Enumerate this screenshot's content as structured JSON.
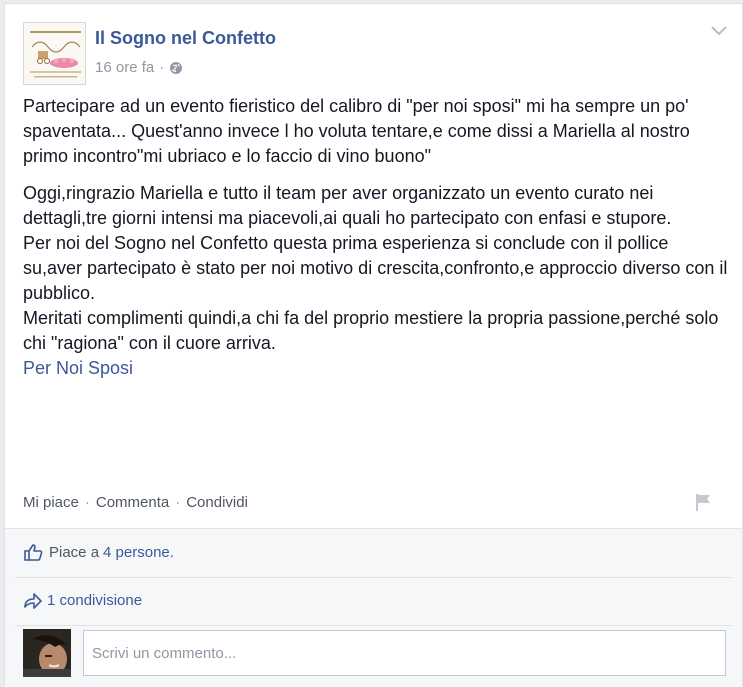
{
  "post": {
    "page_name": "Il Sogno nel Confetto",
    "time": "16 ore fa",
    "dot": "·",
    "audience_icon": "globe-icon",
    "paragraph_1": "Partecipare ad un evento fieristico del calibro di \"per noi sposi\" mi ha sempre un po' spaventata... Quest'anno invece l ho voluta tentare,e come dissi a Mariella al nostro primo incontro\"mi ubriaco e lo faccio di vino buono\"",
    "paragraph_2": "Oggi,ringrazio Mariella e tutto il team per aver organizzato un evento curato nei dettagli,tre giorni intensi ma piacevoli,ai quali ho partecipato con enfasi e stupore.",
    "paragraph_3": "Per noi del Sogno nel Confetto questa prima esperienza si conclude con il pollice su,aver partecipato è stato per noi motivo di crescita,confronto,e approccio diverso con il pubblico.",
    "paragraph_4": "Meritati complimenti quindi,a chi fa del proprio mestiere la propria passione,perché solo chi \"ragiona\" con il cuore arriva.",
    "tag": "Per Noi Sposi"
  },
  "actions": {
    "like": "Mi piace",
    "comment": "Commenta",
    "share": "Condividi",
    "sep": "·",
    "flag_icon": "flag-icon"
  },
  "ufi": {
    "likes_prefix": "Piace a",
    "likes_count": "4 persone.",
    "shares": "1 condivisione",
    "comment_placeholder": "Scrivi un commento..."
  },
  "colors": {
    "link": "#3b5998",
    "muted": "#9197a3",
    "ufi_bg": "#f6f7f9"
  }
}
